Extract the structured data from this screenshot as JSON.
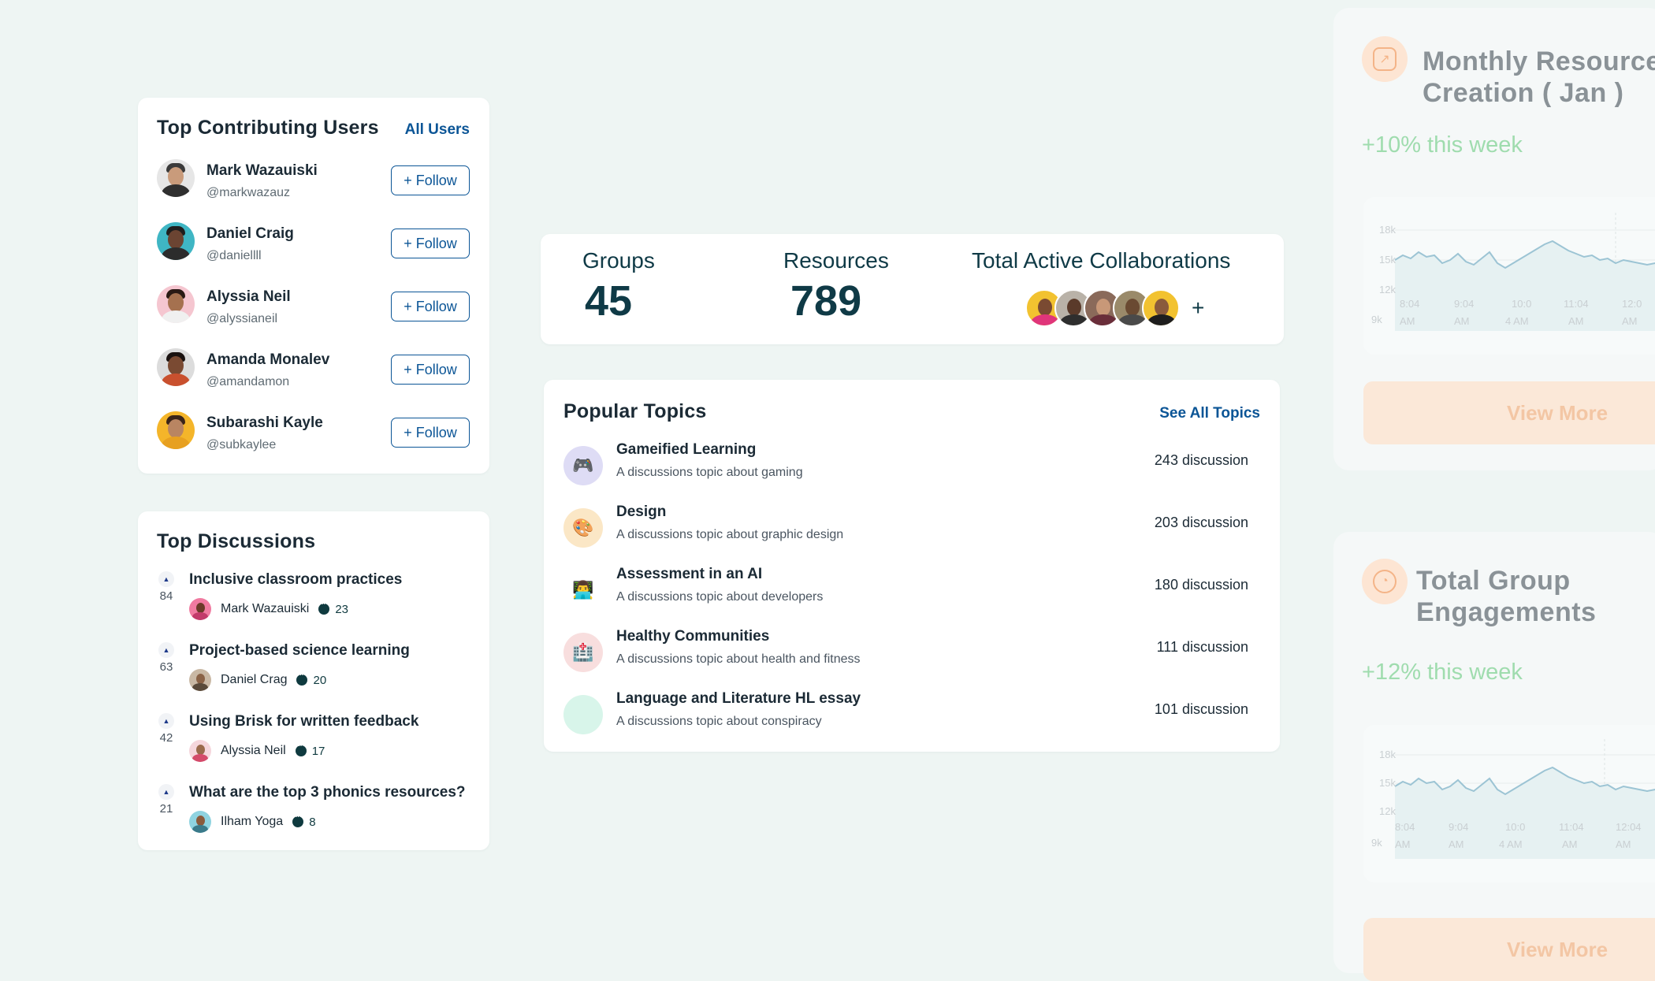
{
  "top_users": {
    "title": "Top Contributing Users",
    "all_link": "All Users",
    "users": [
      {
        "name": "Mark Wazauiski",
        "handle": "@markwazauz",
        "follow": "+ Follow"
      },
      {
        "name": "Daniel Craig",
        "handle": "@daniellll",
        "follow": "+ Follow"
      },
      {
        "name": "Alyssia Neil",
        "handle": "@alyssianeil",
        "follow": "+ Follow"
      },
      {
        "name": "Amanda Monalev",
        "handle": "@amandamon",
        "follow": "+ Follow"
      },
      {
        "name": "Subarashi Kayle",
        "handle": "@subkaylee",
        "follow": "+ Follow"
      }
    ]
  },
  "top_discussions": {
    "title": "Top Discussions",
    "items": [
      {
        "votes": "84",
        "title": "Inclusive classroom practices",
        "author": "Mark Wazauiski",
        "comments": "23"
      },
      {
        "votes": "63",
        "title": "Project-based science learning",
        "author": "Daniel Crag",
        "comments": "20"
      },
      {
        "votes": "42",
        "title": "Using Brisk for written feedback",
        "author": "Alyssia Neil",
        "comments": "17"
      },
      {
        "votes": "21",
        "title": "What are the top 3 phonics resources?",
        "author": "Ilham Yoga",
        "comments": "8"
      }
    ]
  },
  "stats": {
    "groups_label": "Groups",
    "groups_value": "45",
    "resources_label": "Resources",
    "resources_value": "789",
    "collab_label": "Total Active Collaborations",
    "collab_more": "+"
  },
  "popular_topics": {
    "title": "Popular Topics",
    "see_all": "See All Topics",
    "topics": [
      {
        "icon": "gamepad-icon",
        "title": "Gameified Learning",
        "desc": "A discussions topic about gaming",
        "count": "243 discussion",
        "color": "#dedcf5"
      },
      {
        "icon": "palette-icon",
        "title": "Design",
        "desc": "A discussions topic about graphic design",
        "count": "203 discussion",
        "color": "#fbe7c6"
      },
      {
        "icon": "developer-icon",
        "title": "Assessment in an AI",
        "desc": "A discussions topic about developers",
        "count": "180 discussion",
        "color": "#ffffff"
      },
      {
        "icon": "hospital-icon",
        "title": "Healthy Communities",
        "desc": "A discussions topic about health and fitness",
        "count": "111 discussion",
        "color": "#f8dede"
      },
      {
        "icon": "blank-icon",
        "title": "Language and Literature HL essay",
        "desc": "A discussions topic about conspiracy",
        "count": "101 discussion",
        "color": "#d8f5ea"
      }
    ]
  },
  "monthly_panel": {
    "title_line1": "Monthly Resource",
    "title_line2": "Creation  ( Jan )",
    "growth": "+10% this week",
    "y_ticks": [
      "18k",
      "15k",
      "12k",
      "9k"
    ],
    "x_ticks_top": [
      "8:04",
      "9:04",
      "10:0",
      "11:04",
      "12:0"
    ],
    "x_ticks_bottom": [
      "AM",
      "AM",
      "4 AM",
      "AM",
      "AM"
    ],
    "button": "View More"
  },
  "engagement_panel": {
    "title_line1": "Total Group",
    "title_line2": "Engagements",
    "growth": "+12% this week",
    "y_ticks": [
      "18k",
      "15k",
      "12k",
      "9k"
    ],
    "x_ticks_top": [
      "8:04",
      "9:04",
      "10:0",
      "11:04",
      "12:04"
    ],
    "x_ticks_bottom": [
      "AM",
      "AM",
      "4 AM",
      "AM",
      "AM"
    ],
    "button": "View More"
  },
  "colors": {
    "brand_link": "#0b5596",
    "stat_text": "#0f3a46",
    "growth_green": "#9fdcae",
    "accent_peach": "#fbe8d8"
  }
}
